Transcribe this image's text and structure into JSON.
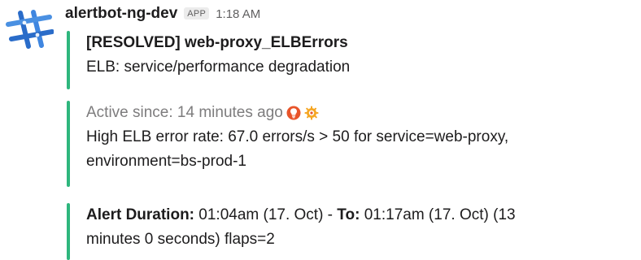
{
  "message": {
    "sender": "alertbot-ng-dev",
    "badge": "APP",
    "time": "1:18 AM",
    "avatar_icon": "slack-hash-logo-icon"
  },
  "colors": {
    "attachment_bar": "#2eb67d",
    "secondary_text": "#616061",
    "pretext": "#7d7c7d"
  },
  "attachments": [
    {
      "title": "[RESOLVED] web-proxy_ELBErrors",
      "text": "ELB: service/performance degradation"
    },
    {
      "pretext": "Active since: 14 minutes ago",
      "icons": [
        "pagerduty-bulb-icon",
        "grafana-icon"
      ],
      "text_line1": "High ELB error rate: 67.0 errors/s > 50 for service=web-proxy,",
      "text_line2": "environment=bs-prod-1"
    },
    {
      "duration_label": "Alert Duration:",
      "duration_from": " 01:04am (17. Oct) - ",
      "to_label": "To:",
      "duration_to": " 01:17am (17. Oct) (13",
      "line2": "minutes 0 seconds) flaps=2"
    }
  ]
}
